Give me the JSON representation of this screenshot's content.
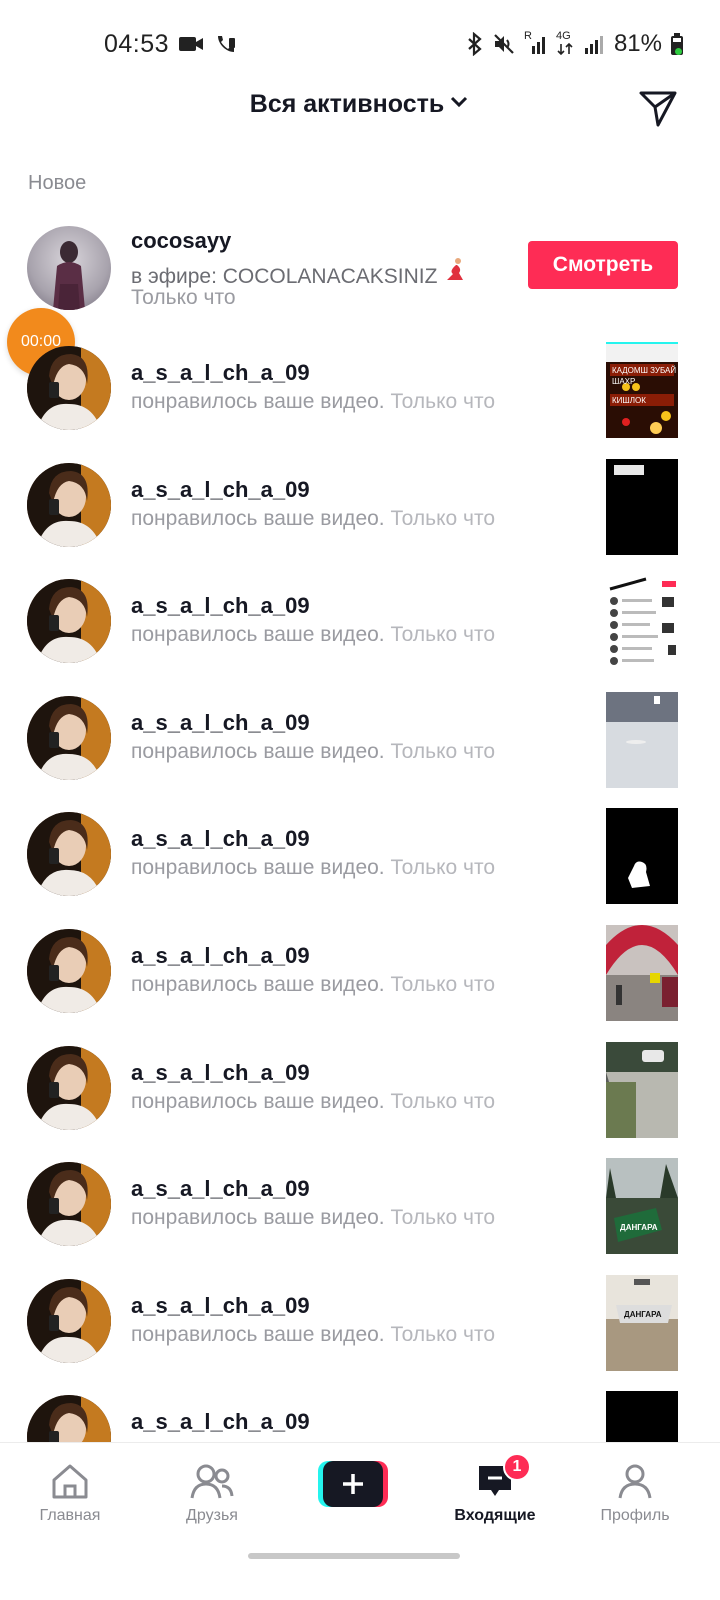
{
  "status_bar": {
    "time": "04:53",
    "battery": "81%",
    "network_r": "R",
    "network_4g": "4G"
  },
  "header": {
    "title": "Вся активность"
  },
  "section": {
    "label": "Новое"
  },
  "live_row": {
    "username": "cocosayy",
    "text": "в эфире: COCOLANACAKSINIZ",
    "time": "Только что",
    "button_label": "Смотреть"
  },
  "timer_bubble": "00:00",
  "activity_rows": [
    {
      "username": "a_s_a_l_ch_a_09",
      "action": "понравилось ваше видео.",
      "time": "Только что"
    },
    {
      "username": "a_s_a_l_ch_a_09",
      "action": "понравилось ваше видео.",
      "time": "Только что"
    },
    {
      "username": "a_s_a_l_ch_a_09",
      "action": "понравилось ваше видео.",
      "time": "Только что"
    },
    {
      "username": "a_s_a_l_ch_a_09",
      "action": "понравилось ваше видео.",
      "time": "Только что"
    },
    {
      "username": "a_s_a_l_ch_a_09",
      "action": "понравилось ваше видео.",
      "time": "Только что"
    },
    {
      "username": "a_s_a_l_ch_a_09",
      "action": "понравилось ваше видео.",
      "time": "Только что"
    },
    {
      "username": "a_s_a_l_ch_a_09",
      "action": "понравилось ваше видео.",
      "time": "Только что"
    },
    {
      "username": "a_s_a_l_ch_a_09",
      "action": "понравилось ваше видео.",
      "time": "Только что"
    },
    {
      "username": "a_s_a_l_ch_a_09",
      "action": "понравилось ваше видео.",
      "time": "Только что"
    },
    {
      "username": "a_s_a_l_ch_a_09",
      "action": "",
      "time": ""
    }
  ],
  "thumbnails": {
    "t1_lines": [
      "КАДОМШ ЗУБАЙ",
      "ШАХР",
      "КИШЛОК"
    ],
    "t8_sign": "ДАНГАРА",
    "t9_sign": "ДАНГАРА"
  },
  "bottom_nav": {
    "home": "Главная",
    "friends": "Друзья",
    "inbox": "Входящие",
    "profile": "Профиль",
    "inbox_badge": "1"
  },
  "colors": {
    "accent": "#fe2c55",
    "cyan": "#25f4ee",
    "timer": "#f28a1c",
    "text_primary": "#161823",
    "text_secondary": "#9a9ba1"
  }
}
